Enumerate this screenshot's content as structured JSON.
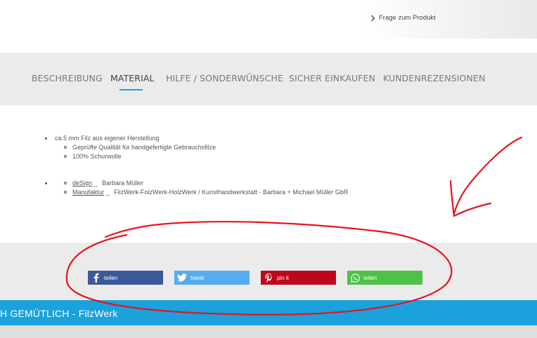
{
  "question": {
    "label": "Frage zum Produkt",
    "icon": "chevron-right-icon"
  },
  "tabs": [
    {
      "label": "BESCHREIBUNG"
    },
    {
      "label": "MATERIAL"
    },
    {
      "label": "HILFE / SONDERWÜNSCHE"
    },
    {
      "label": "SICHER EINKAUFEN"
    },
    {
      "label": "KUNDENREZENSIONEN"
    }
  ],
  "active_tab": "MATERIAL",
  "material": {
    "item1": "ca.5 mm Filz aus eigener Herstellung",
    "sub1": "Geprüfte Qualität für handgefertigte Gebrauchsfilze",
    "sub2": "100% Schurwolle",
    "design_label": "deSign",
    "design_sep": "_",
    "design_value": "Barbara Müller",
    "manufaktur_label": "Manufaktur",
    "manufaktur_sep": "_",
    "manufaktur_value": "FilzWerk-FolzWerk-HolzWerk / Kunsthandwerkstatt - Barbara + Michael Müller GbR"
  },
  "share": {
    "facebook": "teilen",
    "twitter": "tweet",
    "pinterest": "pin it",
    "whatsapp": "teilen"
  },
  "colors": {
    "accent": "#1fa1dc",
    "facebook": "#3b5998",
    "twitter": "#55acee",
    "pinterest": "#bd081c",
    "whatsapp": "#4dc247",
    "annotation": "#e8141c"
  },
  "banner_text": "H GEMÜTLICH  -  FilzWerk"
}
